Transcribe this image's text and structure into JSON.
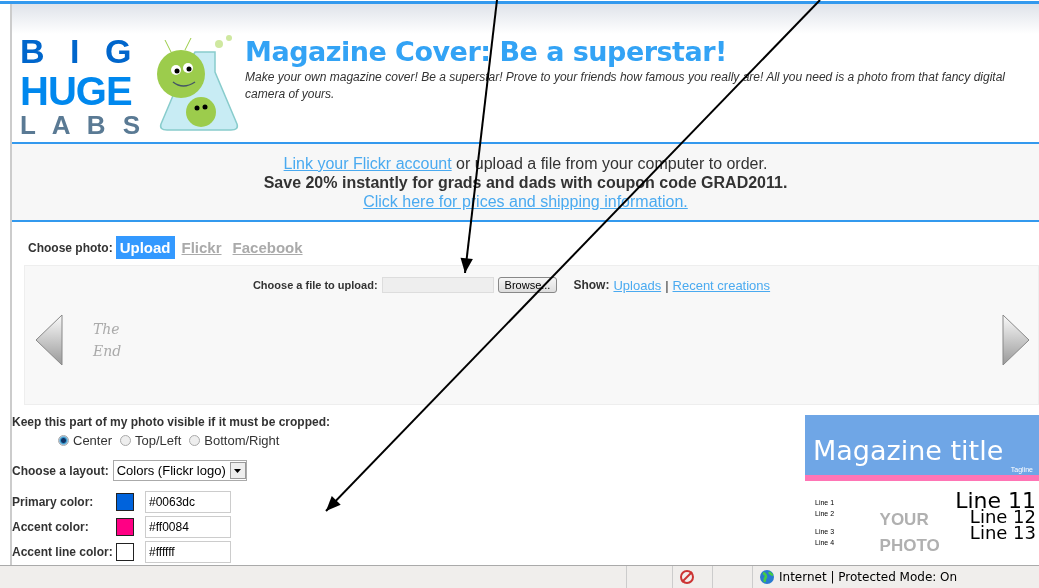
{
  "logo": {
    "lines": [
      "B I G",
      "HUGE",
      "L A B S"
    ]
  },
  "header": {
    "title": "Magazine Cover: Be a superstar!",
    "subtitle": "Make your own magazine cover! Be a superstar! Prove to your friends how famous you really are! All you need is a photo from that fancy digital camera of yours."
  },
  "notice": {
    "link": "Link your Flickr account",
    "text": " or upload a file from your computer to order.",
    "promo": "Save 20% instantly for grads and dads with coupon code GRAD2011.",
    "pricing_link": "Click here for prices and shipping information."
  },
  "choose_photo": {
    "label": "Choose photo:",
    "tabs": [
      {
        "label": "Upload",
        "selected": true
      },
      {
        "label": "Flickr",
        "selected": false
      },
      {
        "label": "Facebook",
        "selected": false
      }
    ]
  },
  "upload": {
    "label": "Choose a file to upload:",
    "browse": "Browse...",
    "show_label": "Show:",
    "links": [
      "Uploads",
      "Recent creations"
    ],
    "separator": "|"
  },
  "thumbnails": [
    {
      "lines": [
        "The",
        "End"
      ]
    }
  ],
  "crop": {
    "label": "Keep this part of my photo visible if it must be cropped:",
    "options": [
      {
        "label": "Center",
        "selected": true
      },
      {
        "label": "Top/Left",
        "selected": false
      },
      {
        "label": "Bottom/Right",
        "selected": false
      }
    ]
  },
  "layout": {
    "label": "Choose a layout:",
    "value": "Colors (Flickr logo)"
  },
  "colors": [
    {
      "label": "Primary color:",
      "color": "#0063dc",
      "value": "#0063dc"
    },
    {
      "label": "Accent color:",
      "color": "#ff0084",
      "value": "#ff0084"
    },
    {
      "label": "Accent line color:",
      "color": "#ffffff",
      "value": "#ffffff"
    }
  ],
  "preview": {
    "title": "Magazine title",
    "tagline": "Tagline",
    "left_lines": [
      "Line 1",
      "Line 2",
      "Line 3",
      "Line 4"
    ],
    "right_lines": [
      "Line 11",
      "Line 12",
      "Line 13"
    ],
    "photo_text": [
      "YOUR",
      "PHOTO"
    ]
  },
  "status_bar": {
    "zone": "Internet | Protected Mode: On"
  }
}
